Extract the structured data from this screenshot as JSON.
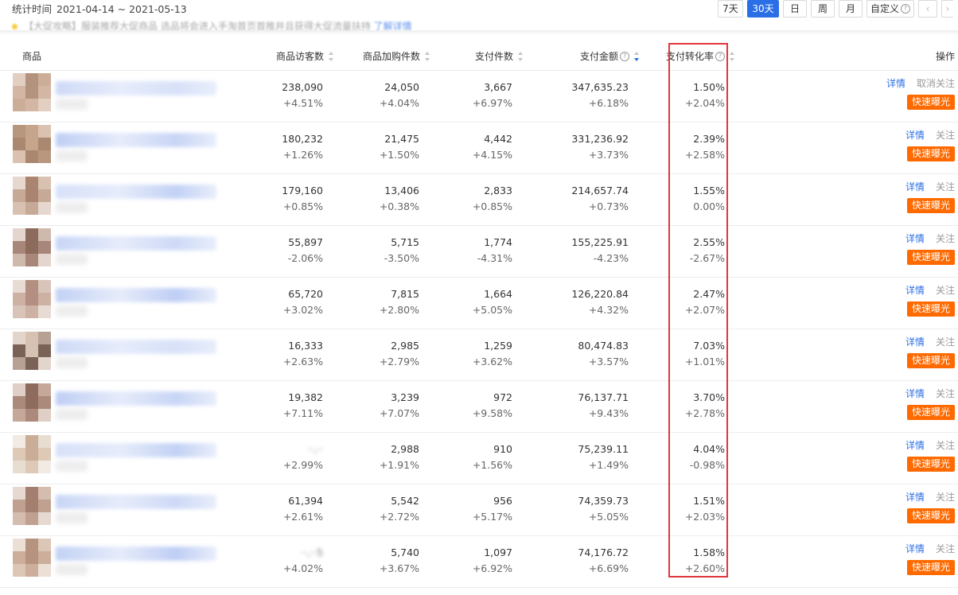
{
  "header": {
    "date_label": "统计时间",
    "date_range": "2021-04-14 ~ 2021-05-13",
    "range_buttons": [
      "7天",
      "30天",
      "日",
      "周",
      "月",
      "自定义"
    ],
    "active_range": "30天",
    "notice_text": "【大促攻略】服装推荐大促商品 选品将会进入手淘首页首推并且获得大促流量扶持 ",
    "notice_link": "了解详情"
  },
  "columns": {
    "product": "商品",
    "visitors": "商品访客数",
    "cart_items": "商品加购件数",
    "paid_items": "支付件数",
    "paid_amount": "支付金额",
    "conversion": "支付转化率",
    "action": "操作"
  },
  "actions": {
    "detail": "详情",
    "unfollow": "取消关注",
    "follow": "关注",
    "expose": "快速曝光"
  },
  "rows": [
    {
      "visitors": "238,090",
      "visitors_d": "+4.51%",
      "cart": "24,050",
      "cart_d": "+4.04%",
      "paid": "3,667",
      "paid_d": "+6.97%",
      "amount": "347,635.23",
      "amount_d": "+6.18%",
      "conv": "1.50%",
      "conv_d": "+2.04%",
      "follow_label": "取消关注"
    },
    {
      "visitors": "180,232",
      "visitors_d": "+1.26%",
      "cart": "21,475",
      "cart_d": "+1.50%",
      "paid": "4,442",
      "paid_d": "+4.15%",
      "amount": "331,236.92",
      "amount_d": "+3.73%",
      "conv": "2.39%",
      "conv_d": "+2.58%",
      "follow_label": "关注"
    },
    {
      "visitors": "179,160",
      "visitors_d": "+0.85%",
      "cart": "13,406",
      "cart_d": "+0.38%",
      "paid": "2,833",
      "paid_d": "+0.85%",
      "amount": "214,657.74",
      "amount_d": "+0.73%",
      "conv": "1.55%",
      "conv_d": "0.00%",
      "follow_label": "关注"
    },
    {
      "visitors": "55,897",
      "visitors_d": "-2.06%",
      "cart": "5,715",
      "cart_d": "-3.50%",
      "paid": "1,774",
      "paid_d": "-4.31%",
      "amount": "155,225.91",
      "amount_d": "-4.23%",
      "conv": "2.55%",
      "conv_d": "-2.67%",
      "follow_label": "关注"
    },
    {
      "visitors": "65,720",
      "visitors_d": "+3.02%",
      "cart": "7,815",
      "cart_d": "+2.80%",
      "paid": "1,664",
      "paid_d": "+5.05%",
      "amount": "126,220.84",
      "amount_d": "+4.32%",
      "conv": "2.47%",
      "conv_d": "+2.07%",
      "follow_label": "关注"
    },
    {
      "visitors": "16,333",
      "visitors_d": "+2.63%",
      "cart": "2,985",
      "cart_d": "+2.79%",
      "paid": "1,259",
      "paid_d": "+3.62%",
      "amount": "80,474.83",
      "amount_d": "+3.57%",
      "conv": "7.03%",
      "conv_d": "+1.01%",
      "follow_label": "关注"
    },
    {
      "visitors": "19,382",
      "visitors_d": "+7.11%",
      "cart": "3,239",
      "cart_d": "+7.07%",
      "paid": "972",
      "paid_d": "+9.58%",
      "amount": "76,137.71",
      "amount_d": "+9.43%",
      "conv": "3.70%",
      "conv_d": "+2.78%",
      "follow_label": "关注"
    },
    {
      "visitors": "··,··",
      "visitors_d": "+2.99%",
      "cart": "2,988",
      "cart_d": "+1.91%",
      "paid": "910",
      "paid_d": "+1.56%",
      "amount": "75,239.11",
      "amount_d": "+1.49%",
      "conv": "4.04%",
      "conv_d": "-0.98%",
      "follow_label": "关注",
      "visitors_masked": true
    },
    {
      "visitors": "61,394",
      "visitors_d": "+2.61%",
      "cart": "5,542",
      "cart_d": "+2.72%",
      "paid": "956",
      "paid_d": "+5.17%",
      "amount": "74,359.73",
      "amount_d": "+5.05%",
      "conv": "1.51%",
      "conv_d": "+2.03%",
      "follow_label": "关注"
    },
    {
      "visitors": "··,··5",
      "visitors_d": "+4.02%",
      "cart": "5,740",
      "cart_d": "+3.67%",
      "paid": "1,097",
      "paid_d": "+6.92%",
      "amount": "74,176.72",
      "amount_d": "+6.69%",
      "conv": "1.58%",
      "conv_d": "+2.60%",
      "follow_label": "关注",
      "visitors_masked": true
    }
  ],
  "colors": {
    "accent": "#2b6fe6",
    "expose_button": "#ff6a00",
    "highlight_box": "#e3343b"
  }
}
